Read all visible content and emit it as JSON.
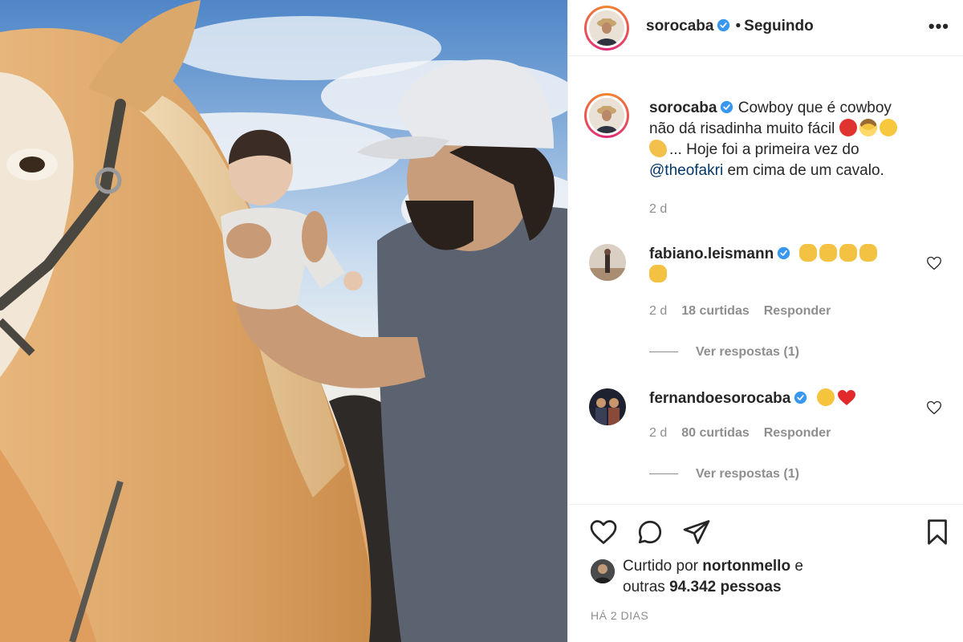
{
  "post": {
    "author": "sorocaba",
    "follow_status": "Seguindo",
    "separator": "•",
    "more_label": "•••"
  },
  "caption": {
    "username": "sorocaba",
    "text_line1": "Cowboy que é cowboy",
    "text_line2": "não dá risadinha muito fácil",
    "text_line3": "... Hoje foi a primeira vez do",
    "mention": "@theofakri",
    "text_line4": " em cima de um cavalo.",
    "time": "2 d"
  },
  "comments": [
    {
      "username": "fabiano.leismann",
      "emojis": [
        "clap",
        "clap",
        "clap",
        "clap",
        "clap"
      ],
      "time": "2 d",
      "likes": "18 curtidas",
      "reply_label": "Responder",
      "view_replies": "Ver respostas (1)"
    },
    {
      "username": "fernandoesorocaba",
      "emojis": [
        "heart-eyes",
        "red-heart"
      ],
      "time": "2 d",
      "likes": "80 curtidas",
      "reply_label": "Responder",
      "view_replies": "Ver respostas (1)"
    }
  ],
  "actions": {
    "icons": [
      "heart-icon",
      "comment-icon",
      "share-icon",
      "bookmark-icon"
    ]
  },
  "likes": {
    "prefix": "Curtido por ",
    "user": "nortonmello",
    "middle": " e",
    "line2_prefix": "outras ",
    "count": "94.342 pessoas"
  },
  "post_age": "HÁ 2 DIAS",
  "colors": {
    "accent_link": "#00376b",
    "verified": "#3897f0",
    "muted": "#8e8e8e",
    "story_ring_start": "#f58529",
    "story_ring_end": "#dd2a7b"
  }
}
